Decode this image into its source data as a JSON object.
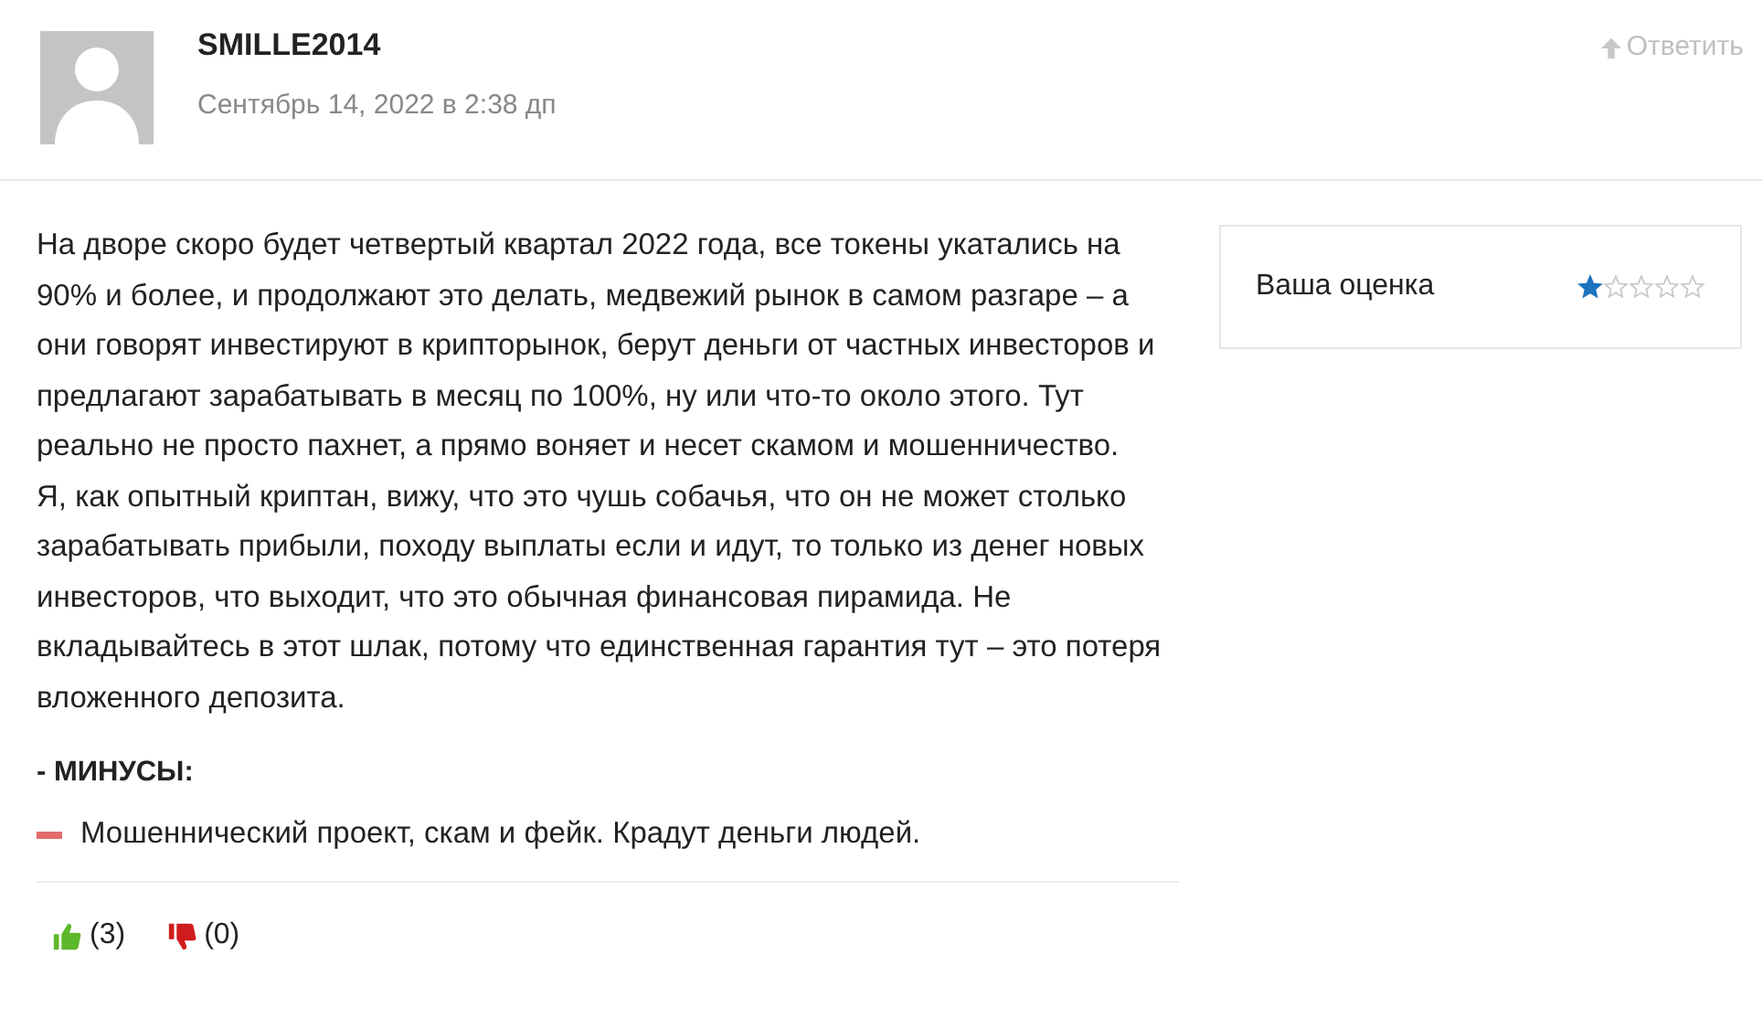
{
  "author": {
    "name": "SMILLE2014",
    "date": "Сентябрь 14, 2022 в 2:38 дп"
  },
  "reply": {
    "label": "Ответить"
  },
  "paragraphs": [
    "На дворе скоро будет четвертый квартал 2022 года, все токены укатались на 90% и более, и продолжают это делать, медвежий рынок в самом разгаре – а они говорят инвестируют в крипторынок, берут деньги от частных инвесторов и предлагают зарабатывать в месяц по 100%, ну или что-то около этого. Тут реально не просто пахнет, а прямо воняет и несет скамом и мошенничество.",
    "Я, как опытный криптан, вижу, что это чушь собачья, что он не может столько зарабатывать прибыли, походу выплаты если и идут, то только из денег новых инвесторов, что выходит, что это обычная финансовая пирамида. Не вкладывайтесь в этот шлак, потому что единственная гарантия тут – это потеря вложенного депозита."
  ],
  "cons": {
    "heading": "- МИНУСЫ:",
    "items": [
      "Мошеннический проект, скам и фейк. Крадут деньги людей."
    ]
  },
  "votes": [
    {
      "kind": "up",
      "count": "(3)"
    },
    {
      "kind": "down",
      "count": "(0)"
    }
  ],
  "rating": {
    "label": "Ваша оценка",
    "stars": 1
  }
}
